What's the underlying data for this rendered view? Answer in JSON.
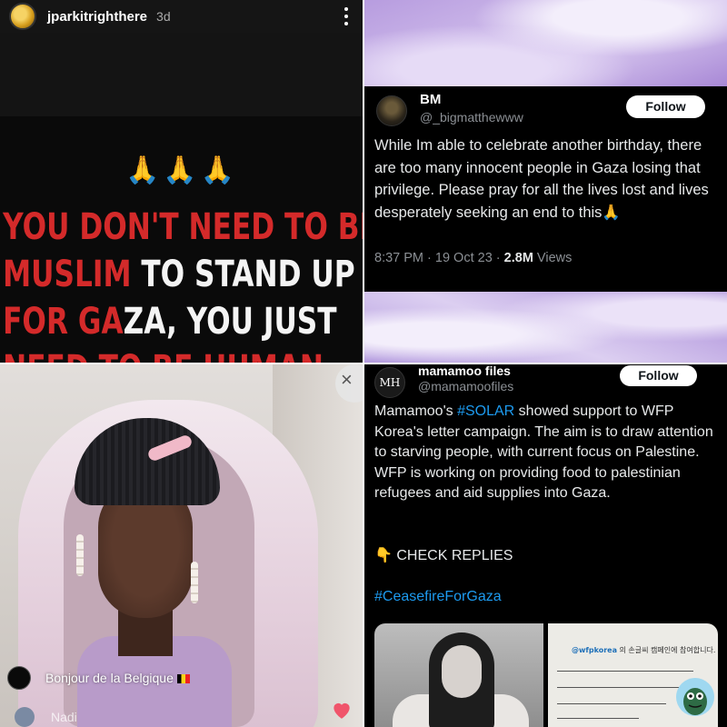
{
  "story": {
    "username": "jparkitrighthere",
    "time_ago": "3d",
    "emoji": "🙏🙏🙏",
    "poster_lines": [
      [
        {
          "t": "YOU DON'T NEED TO BE",
          "c": "r"
        }
      ],
      [
        {
          "t": "MUSLIM",
          "c": "r"
        },
        {
          "t": " TO STAND UP",
          "c": "w"
        }
      ],
      [
        {
          "t": "FOR GA",
          "c": "r"
        },
        {
          "t": "ZA, YOU JUST",
          "c": "w"
        }
      ],
      [
        {
          "t": "NEED TO BE HUMAN.",
          "c": "r"
        }
      ]
    ]
  },
  "tweet1": {
    "name": "BM",
    "handle": "@_bigmatthewww",
    "follow_label": "Follow",
    "body": "While Im able to celebrate another birthday, there are too many innocent people in Gaza losing that privilege. Please pray for all the lives lost and lives desperately seeking an end to this🙏",
    "time": "8:37 PM · 19 Oct 23 · ",
    "views_count": "2.8M",
    "views_label": " Views"
  },
  "live": {
    "comment1_text": "Bonjour de la Belgique",
    "comment2_user": "Nadi",
    "close_icon": "×"
  },
  "tweet2": {
    "avatar_text": "MH",
    "name": "mamamoo files",
    "handle": "@mamamoofiles",
    "follow_label": "Follow",
    "body_pre": "Mamamoo's ",
    "body_tag": "#SOLAR",
    "body_post": " showed support to WFP Korea's letter campaign. The aim is to draw attention to starving people, with current focus on Palestine. WFP is working on providing food to palestinian refugees and aid supplies into Gaza.",
    "check_replies": "👇 CHECK REPLIES",
    "hashtag2": "#CeasefireForGaza",
    "media2_handle": "@wfpkorea",
    "media2_text": "의 손글씨 캠페인에 참여합니다."
  },
  "colors": {
    "link_blue": "#1d9bf0",
    "poster_red": "#d42a2a",
    "lavender": "#c9b3e6"
  }
}
